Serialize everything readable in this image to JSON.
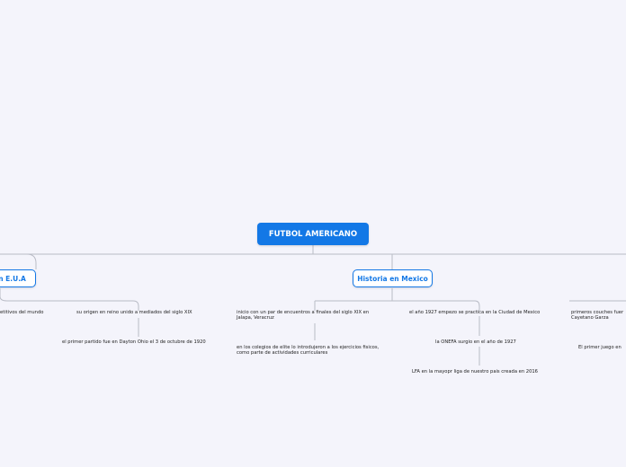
{
  "central": {
    "label": "FUTBOL AMERICANO"
  },
  "topics": {
    "left": {
      "label": "en E.U.A"
    },
    "right": {
      "label": "Historia en Mexico"
    }
  },
  "subtopics": {
    "eua_a": "etitivos del mundo",
    "eua_b": "su origen en reino unido a mediados del siglo XIX",
    "eua_c": "el primer partido fue en Dayton Ohio el 3 de octubre de 1920",
    "mx_a_line1": "inicio con un par de encuentros a finales del siglo XIX en",
    "mx_a_line2": "Jalapa, Veracruz",
    "mx_b_line1": "en los colegios de elite lo introdujeron a los ejercicios fisicos,",
    "mx_b_line2": "como parte de actividades curriculares",
    "mx_c": "el año 1927 empezo se practica en la Ciudad de Mexico",
    "mx_d": "la ONEFA surgio en el año de 1927",
    "mx_e": "LFA en la mayopr liga de nuestro pais creada en 2016",
    "mx_f_line1": "primeros couches fuer",
    "mx_f_line2": "Cayetano Garza",
    "mx_g": "El primer juego en"
  }
}
